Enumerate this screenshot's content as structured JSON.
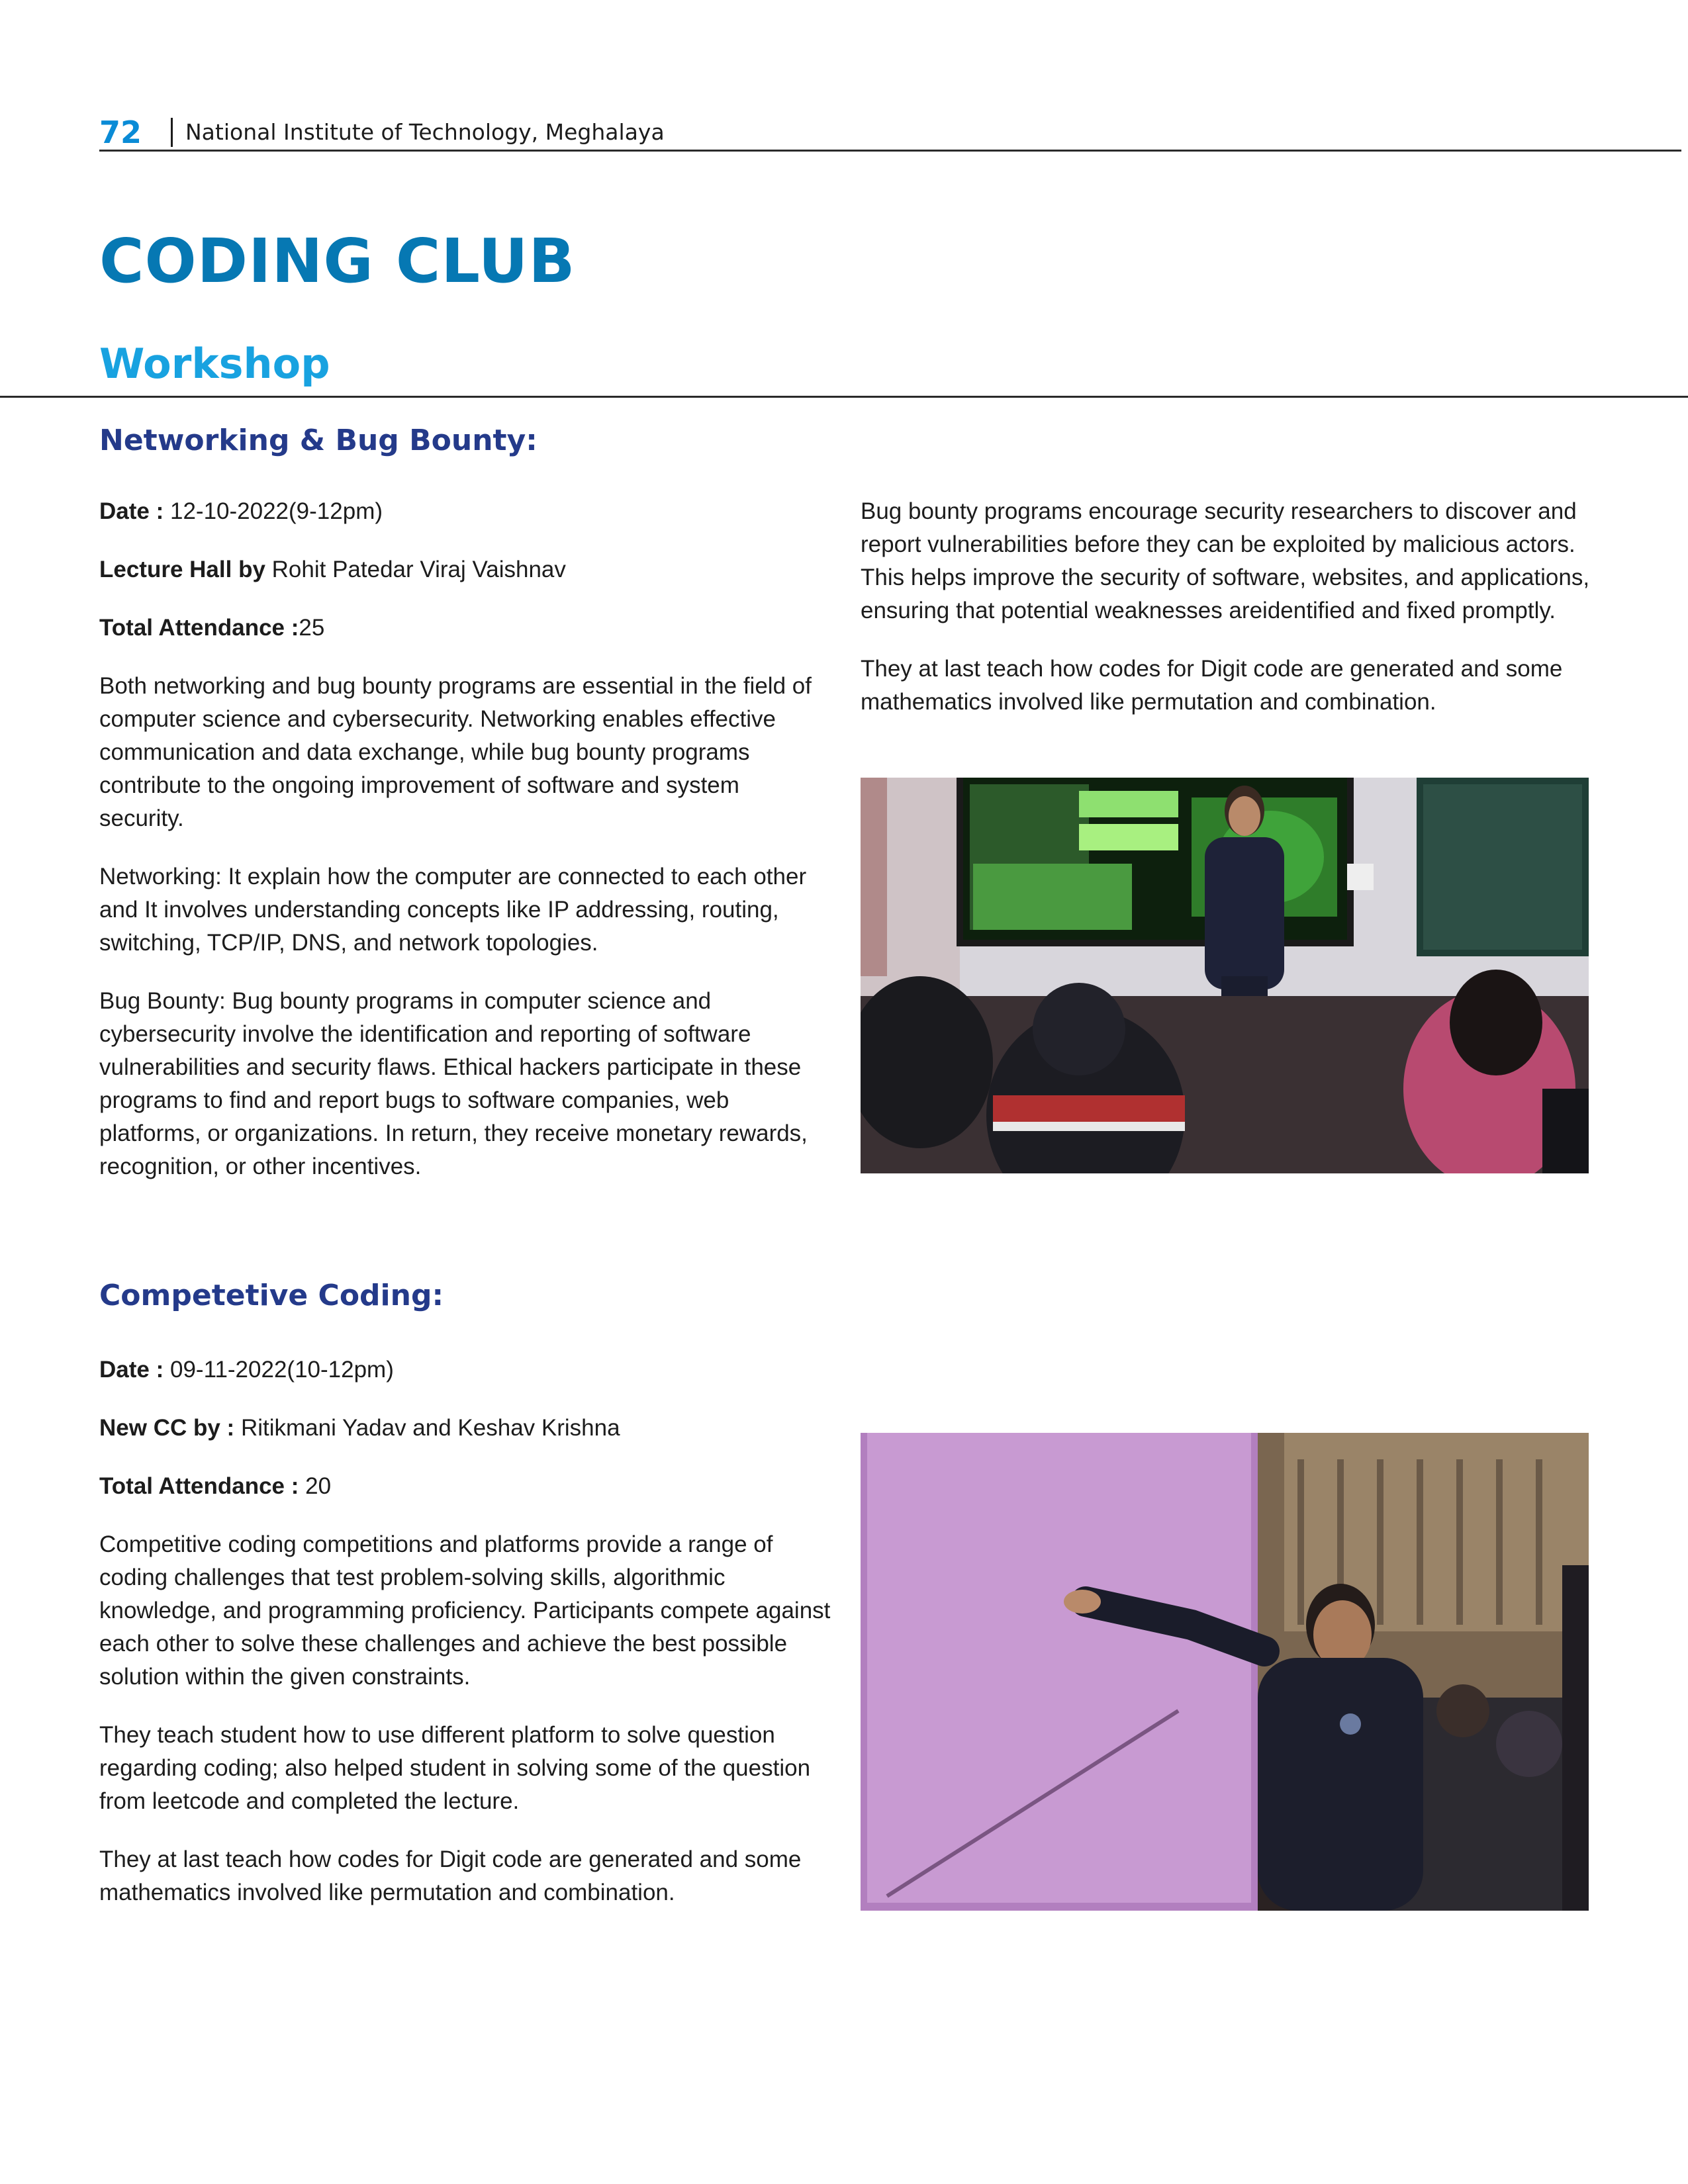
{
  "header": {
    "page_number": "72",
    "institution": "National Institute of Technology, Meghalaya"
  },
  "title": "CODING CLUB",
  "subtitle": "Workshop",
  "section1": {
    "heading": "Networking & Bug Bounty:",
    "date_label": "Date :",
    "date_value": "12-10-2022(9-12pm)",
    "lecture_label": "Lecture Hall by",
    "lecture_value": "Rohit Patedar Viraj Vaishnav",
    "attendance_label": "Total Attendance :",
    "attendance_value": "25",
    "paragraphs": [
      "Both networking and bug bounty programs are essential in the field of computer science and cybersecurity. Networking enables effective communication and data exchange, while bug bounty programs contribute to the ongoing improvement of software and system security.",
      "Networking: It explain how the computer are connected to each other and It involves understanding concepts like IP addressing, routing, switching, TCP/IP, DNS, and network topologies.",
      "Bug Bounty: Bug bounty programs in computer science and cybersecurity involve the identification and reporting of software vulnerabilities and security flaws. Ethical hackers participate in these programs to find and report bugs to software companies, web platforms, or organizations. In return, they receive monetary rewards, recognition, or other incentives."
    ],
    "right_paragraphs": [
      "Bug bounty programs encourage security researchers to discover and report vulnerabilities before they can be exploited by malicious actors. This helps improve the security of software, websites, and applications, ensuring that potential weaknesses areidentified and fixed promptly.",
      "They at last teach how codes for Digit code are generated and some mathematics involved like permutation and combination."
    ]
  },
  "section2": {
    "heading": "Competetive Coding:",
    "date_label": "Date :",
    "date_value": "09-11-2022(10-12pm)",
    "cc_label": "New CC by :",
    "cc_value": "Ritikmani Yadav and Keshav Krishna",
    "attendance_label": "Total Attendance :",
    "attendance_value": "20",
    "paragraphs": [
      "Competitive coding competitions and platforms provide a range of coding challenges that test problem-solving skills, algorithmic knowledge, and programming proficiency. Participants compete against each other to solve these challenges and achieve the best possible solution within the given constraints.",
      "They teach student how to use different platform to solve question regarding coding; also helped student in solving some of the question from leetcode and completed the lecture.",
      "They at last teach how codes for Digit code are generated and some mathematics involved like permutation and combination."
    ]
  },
  "colors": {
    "page_number": "#0a8bd6",
    "title": "#0678b3",
    "subtitle": "#18a2e0",
    "section_heading": "#243a8a"
  }
}
